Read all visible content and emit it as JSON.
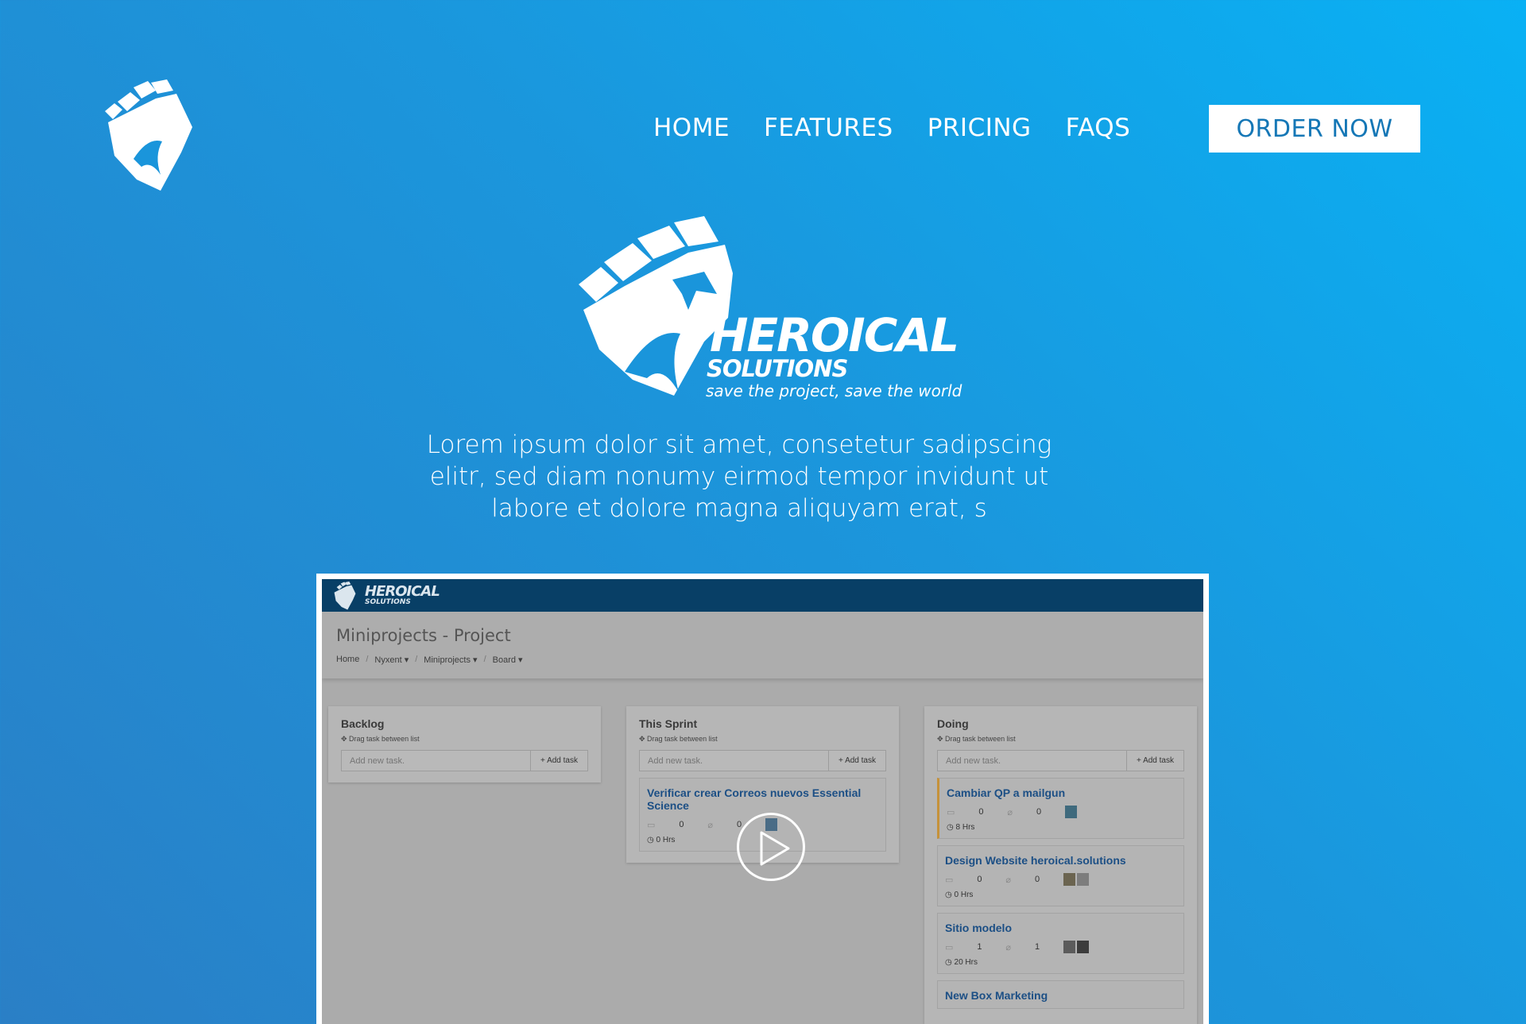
{
  "nav": {
    "items": [
      "HOME",
      "FEATURES",
      "PRICING",
      "FAQS"
    ],
    "cta": "ORDER NOW"
  },
  "hero": {
    "brand_name": "HEROICAL",
    "brand_sub": "SOLUTIONS",
    "tagline": "save the project, save the world",
    "text": "Lorem ipsum dolor sit amet, consetetur sadipscing elitr, sed diam nonumy eirmod tempor invidunt ut labore et dolore magna aliquyam erat, s"
  },
  "app": {
    "brand": "HEROICAL",
    "brand_sub": "SOLUTIONS",
    "title": "Miniprojects - Project",
    "breadcrumb": [
      "Home",
      "Nyxent",
      "Miniprojects",
      "Board"
    ],
    "columns": [
      {
        "title": "Backlog",
        "hint": "Drag task between list",
        "placeholder": "Add new task.",
        "add_label": "+ Add task",
        "cards": []
      },
      {
        "title": "This Sprint",
        "hint": "Drag task between list",
        "placeholder": "Add new task.",
        "add_label": "+ Add task",
        "cards": [
          {
            "title": "Verificar crear Correos nuevos Essential Science",
            "comments": "0",
            "attachments": "0",
            "time": "0 Hrs"
          }
        ]
      },
      {
        "title": "Doing",
        "hint": "Drag task between list",
        "placeholder": "Add new task.",
        "add_label": "+ Add task",
        "cards": [
          {
            "title": "Cambiar QP a mailgun",
            "comments": "0",
            "attachments": "0",
            "time": "8 Hrs"
          },
          {
            "title": "Design Website heroical.solutions",
            "comments": "0",
            "attachments": "0",
            "time": "0 Hrs"
          },
          {
            "title": "Sitio modelo",
            "comments": "1",
            "attachments": "1",
            "time": "20 Hrs"
          },
          {
            "title": "New Box Marketing"
          }
        ]
      }
    ]
  },
  "colors": {
    "accent": "#1577b6",
    "app_topbar": "#083f66",
    "card_title": "#1c4f85"
  }
}
